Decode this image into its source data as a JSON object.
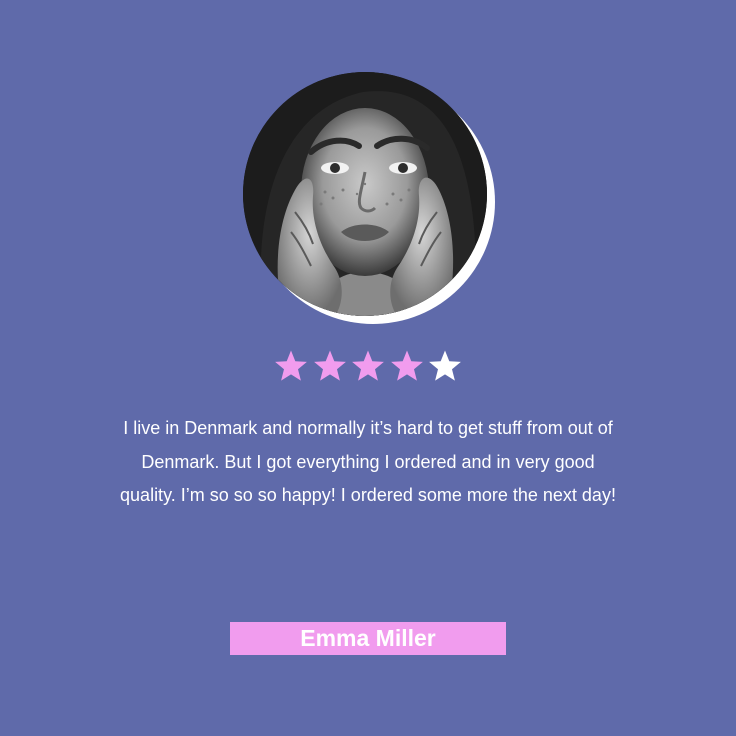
{
  "testimonial": {
    "rating": 4,
    "max_rating": 5,
    "quote": "I live in Denmark and normally it’s hard to get stuff from out of Denmark. But I got everything I ordered and in very good quality. I’m so so so happy! I ordered some more the next day!",
    "name": "Emma Miller"
  },
  "colors": {
    "background": "#5f6aaa",
    "accent": "#f19cee",
    "star_filled": "#f19cee",
    "star_empty": "#ffffff",
    "text": "#ffffff"
  },
  "icons": {
    "star": "star-icon"
  }
}
